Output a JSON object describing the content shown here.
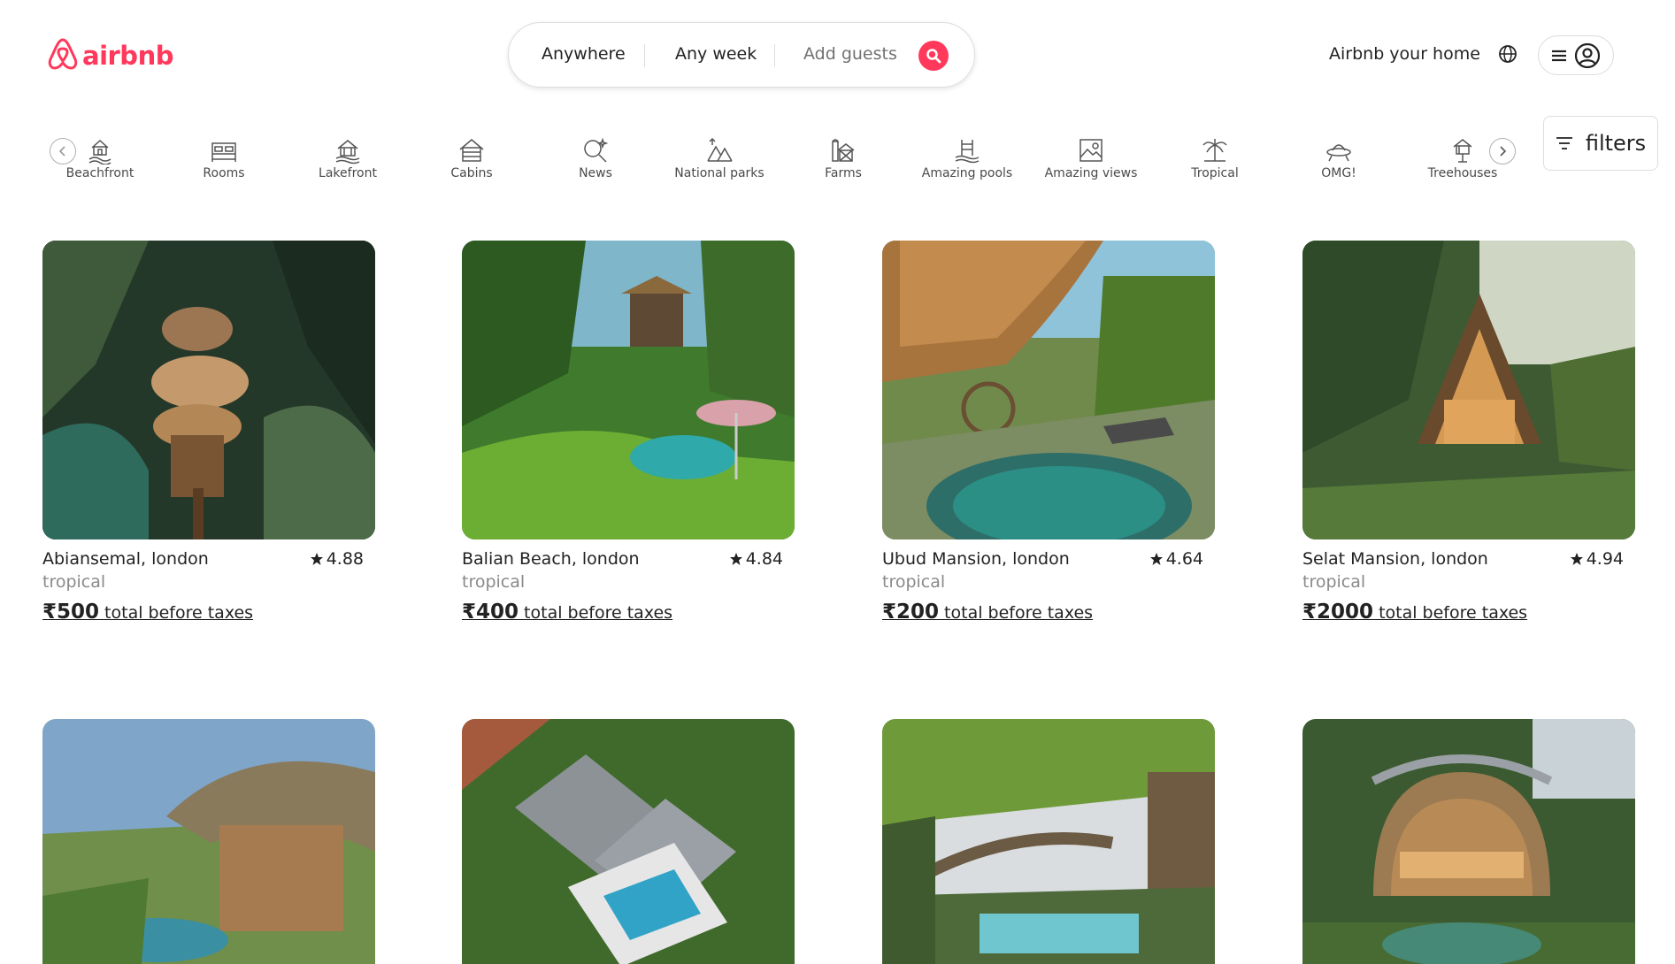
{
  "brand": {
    "name": "airbnb",
    "color": "#FF385C"
  },
  "search": {
    "where": "Anywhere",
    "when": "Any week",
    "who": "Add guests",
    "button_icon": "search-icon"
  },
  "header": {
    "host_link": "Airbnb your home",
    "globe_icon": "globe-icon",
    "menu_icon": "hamburger-icon",
    "avatar_icon": "user-circle-icon"
  },
  "categories": [
    {
      "label": "Beachfront",
      "icon": "beach-icon"
    },
    {
      "label": "Rooms",
      "icon": "bed-icon"
    },
    {
      "label": "Lakefront",
      "icon": "lake-house-icon"
    },
    {
      "label": "Cabins",
      "icon": "cabin-icon"
    },
    {
      "label": "News",
      "icon": "sparkle-search-icon"
    },
    {
      "label": "National parks",
      "icon": "park-icon"
    },
    {
      "label": "Farms",
      "icon": "barn-icon"
    },
    {
      "label": "Amazing pools",
      "icon": "pool-icon"
    },
    {
      "label": "Amazing views",
      "icon": "view-icon"
    },
    {
      "label": "Tropical",
      "icon": "palm-icon"
    },
    {
      "label": "OMG!",
      "icon": "ufo-icon"
    },
    {
      "label": "Treehouses",
      "icon": "treehouse-icon"
    }
  ],
  "filters": {
    "label": "filters",
    "icon": "filter-lines-icon"
  },
  "listings": [
    {
      "title": "Abiansemal, london",
      "rating": "4.88",
      "subtitle": "tropical",
      "price": "₹500",
      "price_suffix": " total before taxes"
    },
    {
      "title": "Balian Beach, london",
      "rating": "4.84",
      "subtitle": "tropical",
      "price": "₹400",
      "price_suffix": " total before taxes"
    },
    {
      "title": "Ubud Mansion, london",
      "rating": "4.64",
      "subtitle": "tropical",
      "price": "₹200",
      "price_suffix": " total before taxes"
    },
    {
      "title": "Selat Mansion, london",
      "rating": "4.94",
      "subtitle": "tropical",
      "price": "₹2000",
      "price_suffix": " total before taxes"
    }
  ]
}
